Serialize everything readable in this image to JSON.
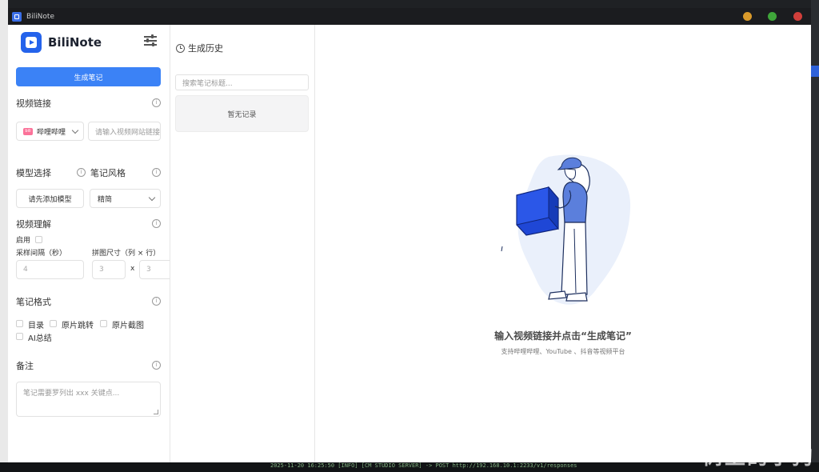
{
  "window": {
    "title": "BiliNote"
  },
  "brand": {
    "name": "BiliNote"
  },
  "sidebar": {
    "generate_button": "生成笔记",
    "video_link_label": "视频链接",
    "platform_selected": "哔哩哔哩",
    "video_url_placeholder": "请输入视频网站链接",
    "model_label": "模型选择",
    "style_label": "笔记风格",
    "add_model_button": "请先添加模型",
    "style_selected": "精简",
    "video_understanding_label": "视频理解",
    "enable_label": "启用",
    "sample_interval_label": "采样间隔（秒）",
    "grid_size_label": "拼图尺寸（列 × 行）",
    "sample_interval_value": "4",
    "grid_cols_value": "3",
    "grid_rows_value": "3",
    "times_sign": "x",
    "note_format_label": "笔记格式",
    "format_options": [
      "目录",
      "原片跳转",
      "原片截图",
      "AI总结"
    ],
    "remark_label": "备注",
    "remark_placeholder": "笔记需要罗列出 xxx 关键点..."
  },
  "history": {
    "title": "生成历史",
    "search_placeholder": "搜索笔记标题...",
    "empty_text": "暂无记录"
  },
  "main": {
    "title": "输入视频链接并点击“生成笔记”",
    "subtitle": "支持哔哩哔哩、YouTube 、抖音等视频平台"
  },
  "desktop": {
    "terminal_text": "2025-11-20 16:25:50  [INFO] [CM STUDIO SERVER] ->  POST http://192.168.10.1:2233/v1/responses",
    "watermark": "树上的小狗"
  },
  "colors": {
    "primary": "#3b82f6",
    "brand": "#2563eb",
    "bilibili": "#fb7299"
  }
}
